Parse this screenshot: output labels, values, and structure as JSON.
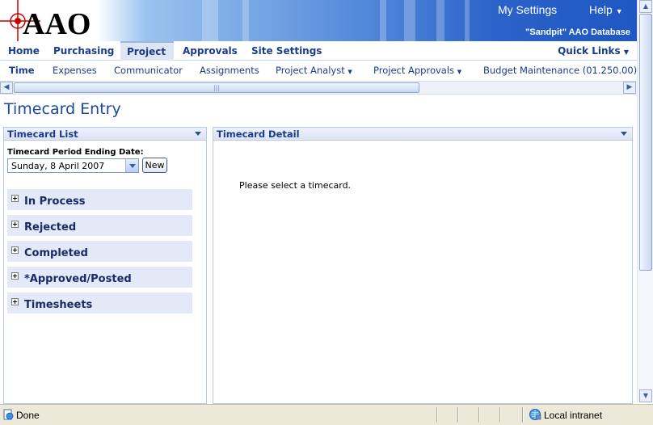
{
  "header": {
    "my_settings": "My Settings",
    "help": "Help",
    "database": "\"Sandpit\" AAO Database",
    "logo_text": "AAO"
  },
  "main_nav": {
    "tabs": [
      "Home",
      "Purchasing",
      "Project",
      "Approvals",
      "Site Settings"
    ],
    "active": "Project",
    "quick_links": "Quick Links"
  },
  "sub_nav": {
    "tabs": [
      "Time",
      "Expenses",
      "Communicator",
      "Assignments",
      "Project Analyst",
      "Project Approvals",
      "Budget Maintenance (01.250.00)"
    ],
    "active": "Time"
  },
  "page": {
    "title": "Timecard Entry"
  },
  "timecard_list": {
    "title": "Timecard List",
    "period_label": "Timecard Period Ending Date:",
    "period_value": "Sunday, 8 April 2007",
    "new_button": "New",
    "groups": [
      "In Process",
      "Rejected",
      "Completed",
      "*Approved/Posted",
      "Timesheets"
    ]
  },
  "timecard_detail": {
    "title": "Timecard Detail",
    "message": "Please select a timecard."
  },
  "status_bar": {
    "status": "Done",
    "zone": "Local intranet"
  },
  "colors": {
    "header_blue": "#2a62c9",
    "nav_text": "#1a3c8c",
    "title_blue": "#1a4ba3",
    "group_bg": "#e3e9f7"
  }
}
